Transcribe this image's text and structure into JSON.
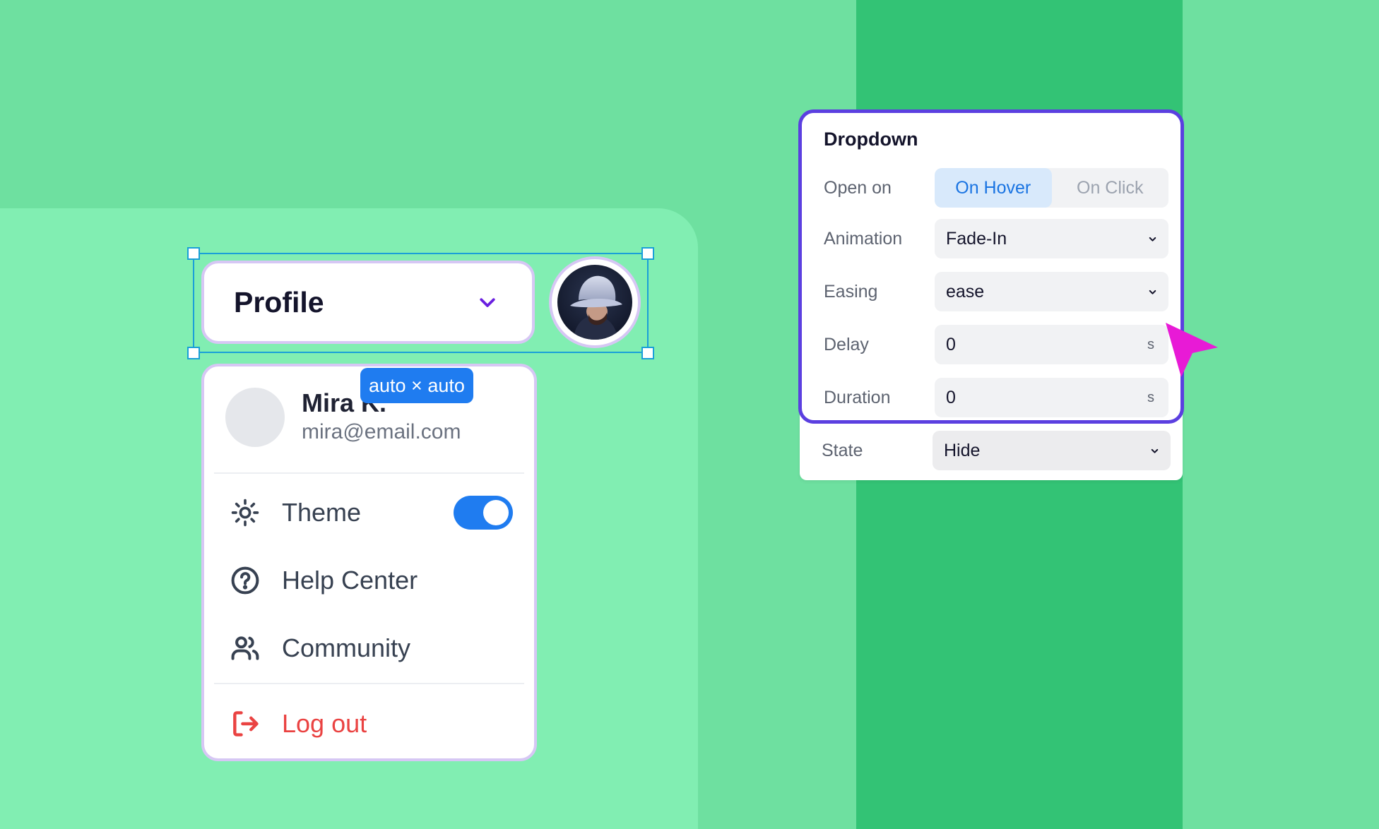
{
  "trigger": {
    "label": "Profile",
    "chevron_icon": "chevron-down-icon"
  },
  "size_badge": "auto × auto",
  "menu": {
    "user_name": "Mira K.",
    "user_email": "mira@email.com",
    "items": [
      {
        "label": "Theme",
        "icon": "sun-icon",
        "toggle_on": true
      },
      {
        "label": "Help Center",
        "icon": "help-circle-icon"
      },
      {
        "label": "Community",
        "icon": "users-icon"
      }
    ],
    "logout_label": "Log out"
  },
  "panel": {
    "title": "Dropdown",
    "open_on": {
      "label": "Open on",
      "options": [
        "On Hover",
        "On Click"
      ],
      "selected": "On Hover"
    },
    "animation": {
      "label": "Animation",
      "value": "Fade-In"
    },
    "easing": {
      "label": "Easing",
      "value": "ease"
    },
    "delay": {
      "label": "Delay",
      "value": "0",
      "unit": "s"
    },
    "duration": {
      "label": "Duration",
      "value": "0",
      "unit": "s"
    },
    "state": {
      "label": "State",
      "value": "Hide"
    }
  },
  "colors": {
    "accent_blue": "#1f7cf0",
    "panel_border": "#5b3fe0",
    "logout_red": "#ea4342",
    "cursor_magenta": "#e81ad6"
  }
}
